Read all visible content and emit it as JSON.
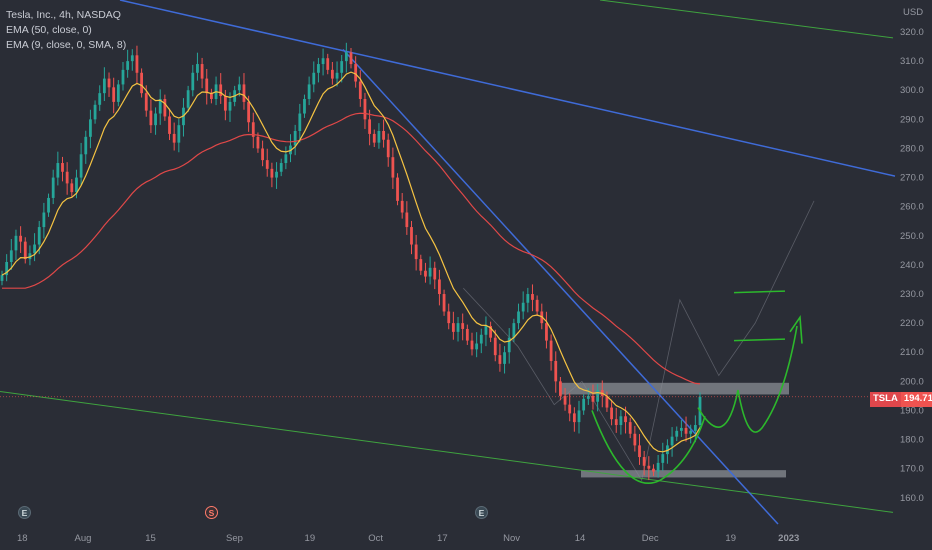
{
  "header": {
    "symbol_line": "Tesla, Inc., 4h, NASDAQ",
    "ema50_label": "EMA (50, close, 0)",
    "ema9_label": "EMA (9, close, 0, SMA, 8)"
  },
  "price_tag": {
    "symbol": "TSLA",
    "value": "194.71"
  },
  "colors": {
    "background": "#2a2d36",
    "up": "#26a69a",
    "down": "#ef5350",
    "ema50": "#e04848",
    "ema9": "#f5c342",
    "downtrend": "#3f6bd8",
    "channel": "#3fa33f",
    "cup": "#2cb82c",
    "zone": "#8a8d94"
  },
  "chart_data": {
    "type": "candlestick",
    "currency_label": "USD",
    "y_range": [
      151,
      331
    ],
    "y_ticks": [
      160,
      170,
      180,
      190,
      200,
      210,
      220,
      230,
      240,
      250,
      260,
      270,
      280,
      290,
      300,
      310,
      320
    ],
    "x_tick_labels": [
      "18",
      "Aug",
      "15",
      "Sep",
      "19",
      "Oct",
      "17",
      "Nov",
      "14",
      "Dec",
      "19",
      "2023"
    ],
    "last_price": 194.71,
    "closes": [
      236.5,
      241.0,
      245.0,
      250.0,
      248.0,
      242.0,
      244.0,
      247.0,
      253.0,
      258.0,
      263.0,
      270.0,
      275.0,
      272.0,
      268.0,
      265.0,
      270.0,
      278.0,
      284.0,
      290.0,
      295.0,
      299.0,
      304.0,
      301.0,
      296.0,
      302.0,
      307.0,
      310.0,
      312.0,
      306.0,
      299.0,
      293.0,
      288.0,
      292.0,
      297.0,
      291.0,
      285.0,
      282.0,
      288.0,
      294.0,
      300.0,
      306.0,
      309.0,
      304.0,
      299.0,
      297.0,
      302.0,
      298.0,
      293.0,
      296.0,
      300.0,
      302.0,
      296.0,
      289.0,
      284.0,
      280.0,
      276.0,
      273.0,
      270.0,
      272.0,
      275.0,
      278.0,
      281.0,
      286.0,
      292.0,
      297.0,
      302.0,
      306.0,
      309.0,
      311.0,
      307.0,
      304.0,
      306.0,
      310.0,
      313.0,
      309.0,
      303.0,
      297.0,
      290.0,
      285.0,
      282.0,
      286.0,
      283.0,
      277.0,
      270.0,
      262.0,
      258.0,
      253.0,
      247.0,
      242.0,
      238.0,
      236.0,
      239.0,
      235.0,
      230.0,
      224.0,
      220.0,
      217.0,
      220.0,
      218.0,
      214.0,
      211.0,
      213.0,
      216.0,
      219.0,
      215.0,
      209.0,
      206.0,
      210.0,
      215.0,
      220.0,
      224.0,
      227.0,
      230.0,
      228.0,
      224.0,
      220.0,
      214.0,
      207.0,
      200.0,
      195.0,
      192.0,
      189.0,
      186.0,
      190.0,
      194.0,
      195.0,
      193.0,
      197.0,
      195.0,
      191.0,
      187.0,
      185.0,
      188.0,
      186.0,
      182.0,
      178.0,
      174.0,
      171.0,
      170.0,
      169.0,
      172.0,
      175.0,
      178.0,
      181.0,
      183.0,
      184.0,
      182.0,
      183.0,
      185.0,
      194.71
    ],
    "projection_points": [
      [
        0,
        236
      ],
      [
        150,
        223
      ],
      [
        155,
        194
      ],
      [
        163,
        206
      ],
      [
        168,
        182
      ],
      [
        181,
        249
      ]
    ],
    "range_marker": {
      "from": [
        119,
        168
      ],
      "to": [
        131,
        248
      ]
    }
  }
}
